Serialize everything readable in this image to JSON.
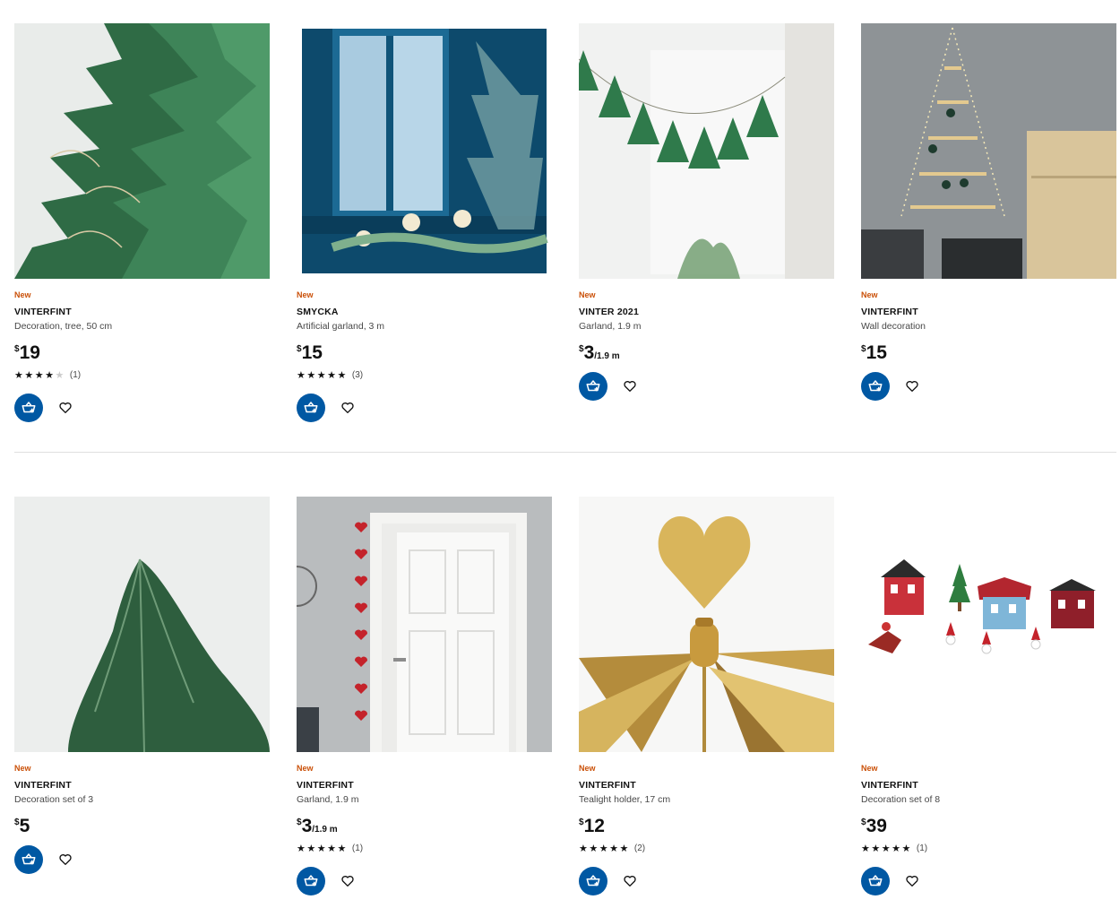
{
  "products": [
    {
      "badge": "New",
      "name": "VINTERFINT",
      "desc": "Decoration, tree, 50 cm",
      "currency": "$",
      "price": "19",
      "unit": "",
      "stars": 4,
      "rating_count": "(1)"
    },
    {
      "badge": "New",
      "name": "SMYCKA",
      "desc": "Artificial garland, 3 m",
      "currency": "$",
      "price": "15",
      "unit": "",
      "stars": 5,
      "rating_count": "(3)"
    },
    {
      "badge": "New",
      "name": "VINTER 2021",
      "desc": "Garland, 1.9 m",
      "currency": "$",
      "price": "3",
      "unit": "/1.9 m",
      "stars": 0,
      "rating_count": ""
    },
    {
      "badge": "New",
      "name": "VINTERFINT",
      "desc": "Wall decoration",
      "currency": "$",
      "price": "15",
      "unit": "",
      "stars": 0,
      "rating_count": ""
    },
    {
      "badge": "New",
      "name": "VINTERFINT",
      "desc": "Decoration set of 3",
      "currency": "$",
      "price": "5",
      "unit": "",
      "stars": 0,
      "rating_count": ""
    },
    {
      "badge": "New",
      "name": "VINTERFINT",
      "desc": "Garland, 1.9 m",
      "currency": "$",
      "price": "3",
      "unit": "/1.9 m",
      "stars": 5,
      "rating_count": "(1)"
    },
    {
      "badge": "New",
      "name": "VINTERFINT",
      "desc": "Tealight holder, 17 cm",
      "currency": "$",
      "price": "12",
      "unit": "",
      "stars": 5,
      "rating_count": "(2)"
    },
    {
      "badge": "New",
      "name": "VINTERFINT",
      "desc": "Decoration set of 8",
      "currency": "$",
      "price": "39",
      "unit": "",
      "stars": 5,
      "rating_count": "(1)"
    }
  ],
  "icons": {
    "cart": "add-to-cart-icon",
    "favourite": "heart-icon",
    "star": "star-icon"
  },
  "colors": {
    "badge_new": "#ca5008",
    "cart_button": "#0058a3"
  }
}
